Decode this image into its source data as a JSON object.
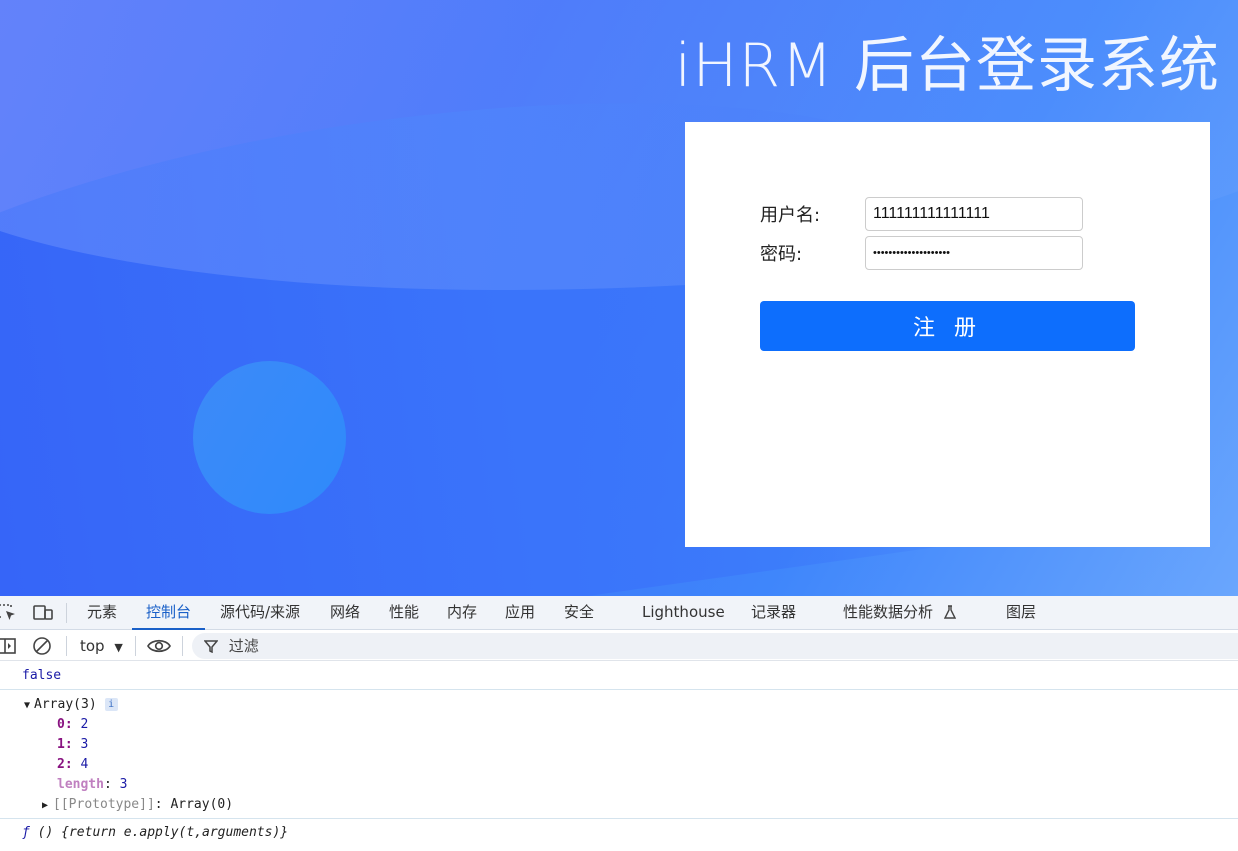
{
  "page": {
    "title": "iHRM 后台登录系统",
    "form": {
      "username_label": "用户名:",
      "username_value": "111111111111111",
      "password_label": "密码:",
      "password_value": "••••••••••••••••••••",
      "submit_label": "注 册"
    }
  },
  "devtools": {
    "tabs": [
      {
        "label": "元素"
      },
      {
        "label": "控制台"
      },
      {
        "label": "源代码/来源"
      },
      {
        "label": "网络"
      },
      {
        "label": "性能"
      },
      {
        "label": "内存"
      },
      {
        "label": "应用"
      },
      {
        "label": "安全"
      },
      {
        "label": "Lighthouse"
      },
      {
        "label": "记录器"
      },
      {
        "label": "性能数据分析"
      },
      {
        "label": "图层"
      }
    ],
    "active_tab": "控制台",
    "context": "top",
    "filter_placeholder": "过滤",
    "console": {
      "line1": "false",
      "array_header": "Array(3)",
      "badge": "i",
      "items": [
        {
          "key": "0",
          "value": "2"
        },
        {
          "key": "1",
          "value": "3"
        },
        {
          "key": "2",
          "value": "4"
        }
      ],
      "length_key": "length",
      "length_value": "3",
      "proto_key": "[[Prototype]]",
      "proto_value": "Array(0)",
      "fn_prefix": "ƒ",
      "fn_body": "() {return e.apply(t,arguments)}"
    }
  }
}
